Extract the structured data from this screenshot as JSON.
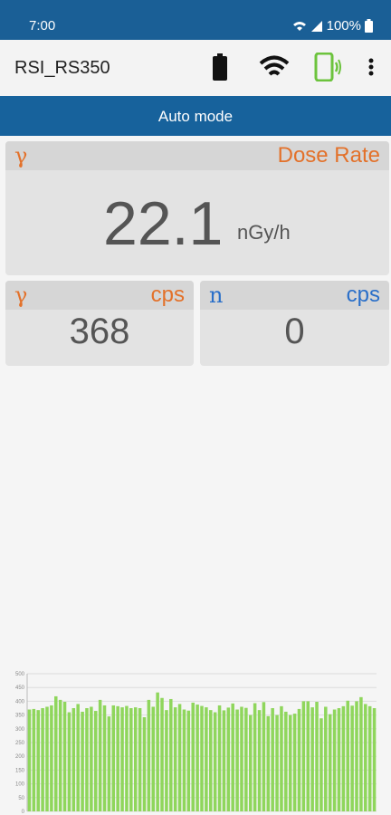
{
  "status": {
    "time": "7:00",
    "battery": "100%",
    "icons": [
      "wifi-calling-icon",
      "signal-icon",
      "battery-icon"
    ]
  },
  "appbar": {
    "title": "RSI_RS350",
    "icons": [
      "battery-icon",
      "wifi-icon",
      "device-connected-icon",
      "more-vert-icon"
    ]
  },
  "mode": {
    "label": "Auto mode"
  },
  "dose_rate": {
    "symbol": "γ",
    "label": "Dose Rate",
    "value": "22.1",
    "unit": "nGy/h"
  },
  "gamma_cps": {
    "symbol": "γ",
    "unit": "cps",
    "value": "368"
  },
  "neutron_cps": {
    "symbol": "n",
    "unit": "cps",
    "value": "0"
  },
  "colors": {
    "accent_orange": "#e3712a",
    "accent_blue": "#2a6fc9",
    "header_blue": "#17629c",
    "bar_green": "#8fd65c"
  },
  "chart_data": {
    "type": "bar",
    "title": "",
    "xlabel": "",
    "ylabel": "",
    "ylim": [
      0,
      500
    ],
    "yticks": [
      0,
      50,
      100,
      150,
      200,
      250,
      300,
      350,
      400,
      450,
      500
    ],
    "grid": true,
    "values": [
      370,
      372,
      368,
      375,
      380,
      385,
      418,
      405,
      398,
      360,
      375,
      390,
      362,
      375,
      380,
      365,
      405,
      385,
      345,
      385,
      382,
      378,
      383,
      375,
      378,
      375,
      342,
      405,
      380,
      432,
      412,
      368,
      408,
      378,
      390,
      370,
      366,
      395,
      388,
      383,
      378,
      368,
      360,
      385,
      367,
      377,
      392,
      370,
      380,
      376,
      350,
      393,
      368,
      397,
      346,
      375,
      350,
      382,
      362,
      350,
      355,
      372,
      400,
      400,
      378,
      398,
      338,
      380,
      353,
      370,
      375,
      382,
      402,
      384,
      400,
      415,
      390,
      382,
      375
    ]
  }
}
